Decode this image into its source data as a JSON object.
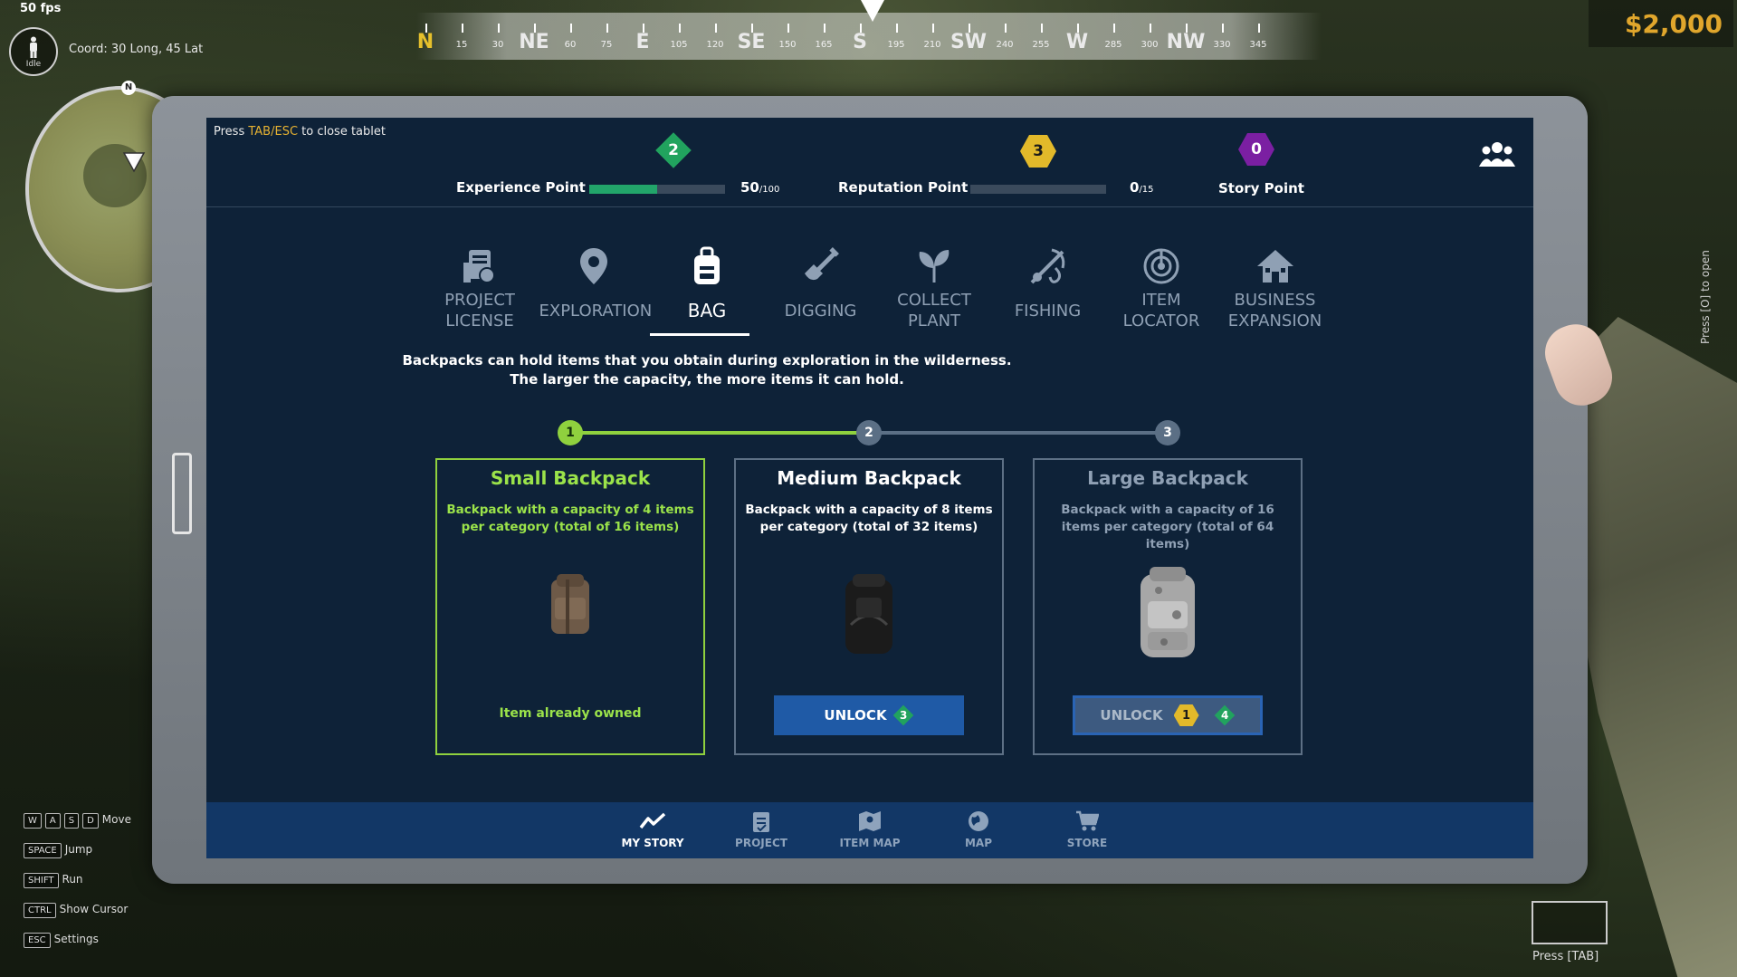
{
  "hud": {
    "fps": "50 fps",
    "status": "Idle",
    "coord": "Coord: 30 Long, 45 Lat",
    "minimap_north": "N",
    "money": "$2,000",
    "compass": [
      {
        "dir": "N",
        "deg": "",
        "color": "#e6c02c"
      },
      {
        "dir": "",
        "deg": "15"
      },
      {
        "dir": "",
        "deg": "30"
      },
      {
        "dir": "NE",
        "deg": ""
      },
      {
        "dir": "",
        "deg": "60"
      },
      {
        "dir": "",
        "deg": "75"
      },
      {
        "dir": "E",
        "deg": ""
      },
      {
        "dir": "",
        "deg": "105"
      },
      {
        "dir": "",
        "deg": "120"
      },
      {
        "dir": "SE",
        "deg": ""
      },
      {
        "dir": "",
        "deg": "150"
      },
      {
        "dir": "",
        "deg": "165"
      },
      {
        "dir": "S",
        "deg": ""
      },
      {
        "dir": "",
        "deg": "195"
      },
      {
        "dir": "",
        "deg": "210"
      },
      {
        "dir": "SW",
        "deg": ""
      },
      {
        "dir": "",
        "deg": "240"
      },
      {
        "dir": "",
        "deg": "255"
      },
      {
        "dir": "W",
        "deg": ""
      },
      {
        "dir": "",
        "deg": "285"
      },
      {
        "dir": "",
        "deg": "300"
      },
      {
        "dir": "NW",
        "deg": ""
      },
      {
        "dir": "",
        "deg": "330"
      },
      {
        "dir": "",
        "deg": "345"
      }
    ],
    "hotkeys": [
      {
        "keys": [
          "W",
          "A",
          "S",
          "D"
        ],
        "label": "Move"
      },
      {
        "keys": [
          "SPACE"
        ],
        "label": "Jump"
      },
      {
        "keys": [
          "SHIFT"
        ],
        "label": "Run"
      },
      {
        "keys": [
          "CTRL"
        ],
        "label": "Show Cursor"
      },
      {
        "keys": [
          "ESC"
        ],
        "label": "Settings"
      }
    ],
    "press_tab": "Press [TAB]",
    "press_o": "Press [O] to open"
  },
  "tablet": {
    "hint_prefix": "Press ",
    "hint_key": "TAB/ESC",
    "hint_suffix": " to close tablet",
    "experience": {
      "label": "Experience Point",
      "value": "50",
      "max": "/100",
      "progress": 0.5,
      "badge": "2"
    },
    "reputation": {
      "label": "Reputation Point",
      "value": "0",
      "max": "/15",
      "progress": 0.0,
      "badge": "3"
    },
    "story": {
      "label": "Story Point",
      "badge": "0"
    },
    "colors": {
      "accent_green": "#22a56a",
      "gold": "#e2b92a",
      "purple": "#7b1fa2",
      "lime": "#8fd13e",
      "screen_bg": "#0e2238",
      "unlock_blue": "#1f5aa6"
    },
    "tabs": [
      {
        "label": "PROJECT\nLICENSE",
        "icon": "project-license-icon",
        "active": false
      },
      {
        "label": "EXPLORATION",
        "icon": "location-pin-icon",
        "active": false
      },
      {
        "label": "BAG",
        "icon": "backpack-icon",
        "active": true
      },
      {
        "label": "DIGGING",
        "icon": "shovel-icon",
        "active": false
      },
      {
        "label": "COLLECT\nPLANT",
        "icon": "plant-icon",
        "active": false
      },
      {
        "label": "FISHING",
        "icon": "fishing-icon",
        "active": false
      },
      {
        "label": "ITEM\nLOCATOR",
        "icon": "locator-icon",
        "active": false
      },
      {
        "label": "BUSINESS\nEXPANSION",
        "icon": "house-icon",
        "active": false
      }
    ],
    "description_1": "Backpacks can hold items that you obtain during exploration in the wilderness.",
    "description_2": "The larger the capacity, the more items it can hold.",
    "steps": [
      "1",
      "2",
      "3"
    ],
    "cards": [
      {
        "title": "Small Backpack",
        "desc": "Backpack with a capacity of 4 items per category (total of 16 items)",
        "status": "Item already owned",
        "state": "owned"
      },
      {
        "title": "Medium Backpack",
        "desc": "Backpack with a capacity of 8 items per category (total of 32 items)",
        "unlock_label": "UNLOCK",
        "cost_xp": "3",
        "state": "available"
      },
      {
        "title": "Large Backpack",
        "desc": "Backpack with a capacity of 16 items per category (total of 64 items)",
        "unlock_label": "UNLOCK",
        "cost_rep": "1",
        "cost_xp": "4",
        "state": "locked"
      }
    ],
    "bottom_nav": [
      {
        "label": "MY STORY",
        "icon": "chart-line-icon",
        "active": true
      },
      {
        "label": "PROJECT",
        "icon": "clipboard-icon",
        "active": false
      },
      {
        "label": "ITEM MAP",
        "icon": "map-marker-icon",
        "active": false
      },
      {
        "label": "MAP",
        "icon": "globe-icon",
        "active": false
      },
      {
        "label": "STORE",
        "icon": "cart-icon",
        "active": false
      }
    ]
  }
}
